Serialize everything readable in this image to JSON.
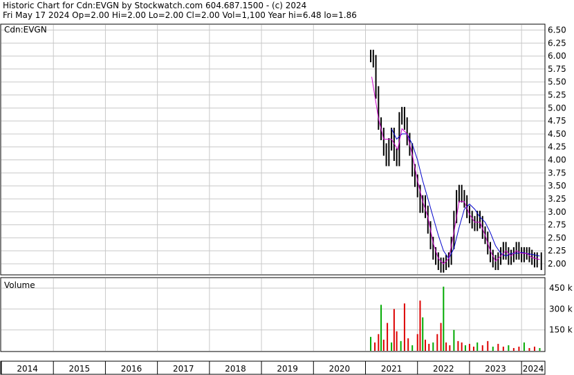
{
  "header": {
    "title": "Historic Chart for Cdn:EVGN by Stockwatch.com 604.687.1500 - (c) 2024",
    "info": "Fri May 17 2024  Op=2.00  Hi=2.00  Lo=2.00  Cl=2.00  Vol=1,100  Year hi=6.48  lo=1.86"
  },
  "colors": {
    "price_bar": "#000000",
    "ma_short": "#cc00cc",
    "ma_long": "#0000cc",
    "volume_up": "#00aa00",
    "volume_down": "#dd0000",
    "grid": "#c8c8c8"
  },
  "chart_data": [
    {
      "type": "line",
      "label": "Cdn:EVGN",
      "ylim": [
        1.8,
        6.6
      ],
      "y_ticks": [
        "6.50",
        "6.25",
        "6.00",
        "5.75",
        "5.50",
        "5.25",
        "5.00",
        "4.75",
        "4.50",
        "4.25",
        "4.00",
        "3.75",
        "3.50",
        "3.25",
        "3.00",
        "2.75",
        "2.50",
        "2.25",
        "2.00"
      ],
      "x_ticks": [
        "2014",
        "2015",
        "2016",
        "2017",
        "2018",
        "2019",
        "2020",
        "2021",
        "2022",
        "2023",
        "2024"
      ],
      "grid": true,
      "series": [
        {
          "name": "price",
          "points": [
            [
              2021.1,
              6.0
            ],
            [
              2021.15,
              5.9
            ],
            [
              2021.2,
              5.3
            ],
            [
              2021.25,
              4.7
            ],
            [
              2021.3,
              4.5
            ],
            [
              2021.35,
              4.2
            ],
            [
              2021.4,
              4.0
            ],
            [
              2021.45,
              4.3
            ],
            [
              2021.5,
              4.5
            ],
            [
              2021.55,
              4.1
            ],
            [
              2021.6,
              4.0
            ],
            [
              2021.65,
              4.8
            ],
            [
              2021.7,
              4.9
            ],
            [
              2021.75,
              4.7
            ],
            [
              2021.8,
              4.4
            ],
            [
              2021.85,
              4.2
            ],
            [
              2021.9,
              3.8
            ],
            [
              2021.95,
              3.6
            ],
            [
              2022.0,
              3.4
            ],
            [
              2022.05,
              3.1
            ],
            [
              2022.1,
              3.2
            ],
            [
              2022.15,
              3.0
            ],
            [
              2022.2,
              2.7
            ],
            [
              2022.25,
              2.4
            ],
            [
              2022.3,
              2.2
            ],
            [
              2022.35,
              2.1
            ],
            [
              2022.4,
              2.0
            ],
            [
              2022.45,
              1.95
            ],
            [
              2022.5,
              2.0
            ],
            [
              2022.55,
              2.05
            ],
            [
              2022.6,
              2.1
            ],
            [
              2022.65,
              2.4
            ],
            [
              2022.7,
              2.9
            ],
            [
              2022.75,
              3.3
            ],
            [
              2022.8,
              3.4
            ],
            [
              2022.85,
              3.3
            ],
            [
              2022.9,
              3.2
            ],
            [
              2022.95,
              3.0
            ],
            [
              2023.0,
              2.9
            ],
            [
              2023.05,
              2.8
            ],
            [
              2023.1,
              2.75
            ],
            [
              2023.15,
              2.9
            ],
            [
              2023.2,
              2.8
            ],
            [
              2023.25,
              2.6
            ],
            [
              2023.3,
              2.5
            ],
            [
              2023.35,
              2.3
            ],
            [
              2023.4,
              2.15
            ],
            [
              2023.45,
              2.05
            ],
            [
              2023.5,
              2.0
            ],
            [
              2023.55,
              2.1
            ],
            [
              2023.6,
              2.2
            ],
            [
              2023.65,
              2.3
            ],
            [
              2023.7,
              2.2
            ],
            [
              2023.75,
              2.1
            ],
            [
              2023.8,
              2.15
            ],
            [
              2023.85,
              2.2
            ],
            [
              2023.9,
              2.3
            ],
            [
              2023.95,
              2.2
            ],
            [
              2024.0,
              2.15
            ],
            [
              2024.05,
              2.2
            ],
            [
              2024.1,
              2.2
            ],
            [
              2024.15,
              2.15
            ],
            [
              2024.2,
              2.1
            ],
            [
              2024.25,
              2.05
            ],
            [
              2024.3,
              2.1
            ],
            [
              2024.38,
              2.0
            ]
          ]
        },
        {
          "name": "short moving average",
          "points": [
            [
              2021.12,
              5.6
            ],
            [
              2021.25,
              4.8
            ],
            [
              2021.35,
              4.4
            ],
            [
              2021.5,
              4.4
            ],
            [
              2021.62,
              4.2
            ],
            [
              2021.7,
              4.6
            ],
            [
              2021.8,
              4.5
            ],
            [
              2021.9,
              4.1
            ],
            [
              2022.0,
              3.6
            ],
            [
              2022.1,
              3.2
            ],
            [
              2022.2,
              2.9
            ],
            [
              2022.3,
              2.4
            ],
            [
              2022.4,
              2.1
            ],
            [
              2022.5,
              2.0
            ],
            [
              2022.6,
              2.1
            ],
            [
              2022.7,
              2.6
            ],
            [
              2022.8,
              3.2
            ],
            [
              2022.9,
              3.2
            ],
            [
              2023.0,
              2.95
            ],
            [
              2023.1,
              2.8
            ],
            [
              2023.2,
              2.8
            ],
            [
              2023.3,
              2.55
            ],
            [
              2023.4,
              2.25
            ],
            [
              2023.5,
              2.05
            ],
            [
              2023.6,
              2.15
            ],
            [
              2023.7,
              2.25
            ],
            [
              2023.8,
              2.15
            ],
            [
              2023.9,
              2.25
            ],
            [
              2024.0,
              2.2
            ],
            [
              2024.1,
              2.2
            ],
            [
              2024.2,
              2.12
            ],
            [
              2024.35,
              2.08
            ]
          ]
        },
        {
          "name": "long moving average",
          "points": [
            [
              2021.5,
              4.6
            ],
            [
              2021.6,
              4.4
            ],
            [
              2021.7,
              4.5
            ],
            [
              2021.8,
              4.5
            ],
            [
              2021.9,
              4.3
            ],
            [
              2022.0,
              4.0
            ],
            [
              2022.1,
              3.6
            ],
            [
              2022.2,
              3.25
            ],
            [
              2022.3,
              2.9
            ],
            [
              2022.4,
              2.55
            ],
            [
              2022.5,
              2.25
            ],
            [
              2022.6,
              2.1
            ],
            [
              2022.7,
              2.3
            ],
            [
              2022.8,
              2.7
            ],
            [
              2022.9,
              3.05
            ],
            [
              2023.0,
              3.15
            ],
            [
              2023.1,
              3.05
            ],
            [
              2023.2,
              2.9
            ],
            [
              2023.3,
              2.8
            ],
            [
              2023.4,
              2.6
            ],
            [
              2023.5,
              2.35
            ],
            [
              2023.6,
              2.2
            ],
            [
              2023.7,
              2.15
            ],
            [
              2023.8,
              2.2
            ],
            [
              2023.9,
              2.2
            ],
            [
              2024.0,
              2.22
            ],
            [
              2024.1,
              2.2
            ],
            [
              2024.2,
              2.18
            ],
            [
              2024.35,
              2.15
            ]
          ]
        }
      ]
    },
    {
      "type": "bar",
      "label": "Volume",
      "ylim": [
        0,
        520000
      ],
      "y_ticks": [
        "450 k",
        "300 k",
        "150 k"
      ],
      "grid": true,
      "series": [
        {
          "name": "volume",
          "points": [
            [
              2021.1,
              100000
            ],
            [
              2021.18,
              60000
            ],
            [
              2021.25,
              120000
            ],
            [
              2021.3,
              330000
            ],
            [
              2021.35,
              80000
            ],
            [
              2021.42,
              200000
            ],
            [
              2021.5,
              60000
            ],
            [
              2021.55,
              300000
            ],
            [
              2021.6,
              140000
            ],
            [
              2021.68,
              70000
            ],
            [
              2021.75,
              340000
            ],
            [
              2021.82,
              90000
            ],
            [
              2021.9,
              40000
            ],
            [
              2022.0,
              120000
            ],
            [
              2022.05,
              360000
            ],
            [
              2022.1,
              240000
            ],
            [
              2022.15,
              80000
            ],
            [
              2022.22,
              50000
            ],
            [
              2022.3,
              60000
            ],
            [
              2022.38,
              120000
            ],
            [
              2022.45,
              200000
            ],
            [
              2022.5,
              460000
            ],
            [
              2022.55,
              60000
            ],
            [
              2022.62,
              40000
            ],
            [
              2022.7,
              150000
            ],
            [
              2022.78,
              70000
            ],
            [
              2022.85,
              60000
            ],
            [
              2022.92,
              40000
            ],
            [
              2023.0,
              50000
            ],
            [
              2023.08,
              30000
            ],
            [
              2023.15,
              60000
            ],
            [
              2023.25,
              40000
            ],
            [
              2023.35,
              70000
            ],
            [
              2023.45,
              30000
            ],
            [
              2023.55,
              50000
            ],
            [
              2023.65,
              30000
            ],
            [
              2023.75,
              40000
            ],
            [
              2023.85,
              20000
            ],
            [
              2023.95,
              30000
            ],
            [
              2024.05,
              60000
            ],
            [
              2024.15,
              20000
            ],
            [
              2024.25,
              30000
            ],
            [
              2024.35,
              20000
            ]
          ]
        }
      ]
    }
  ]
}
